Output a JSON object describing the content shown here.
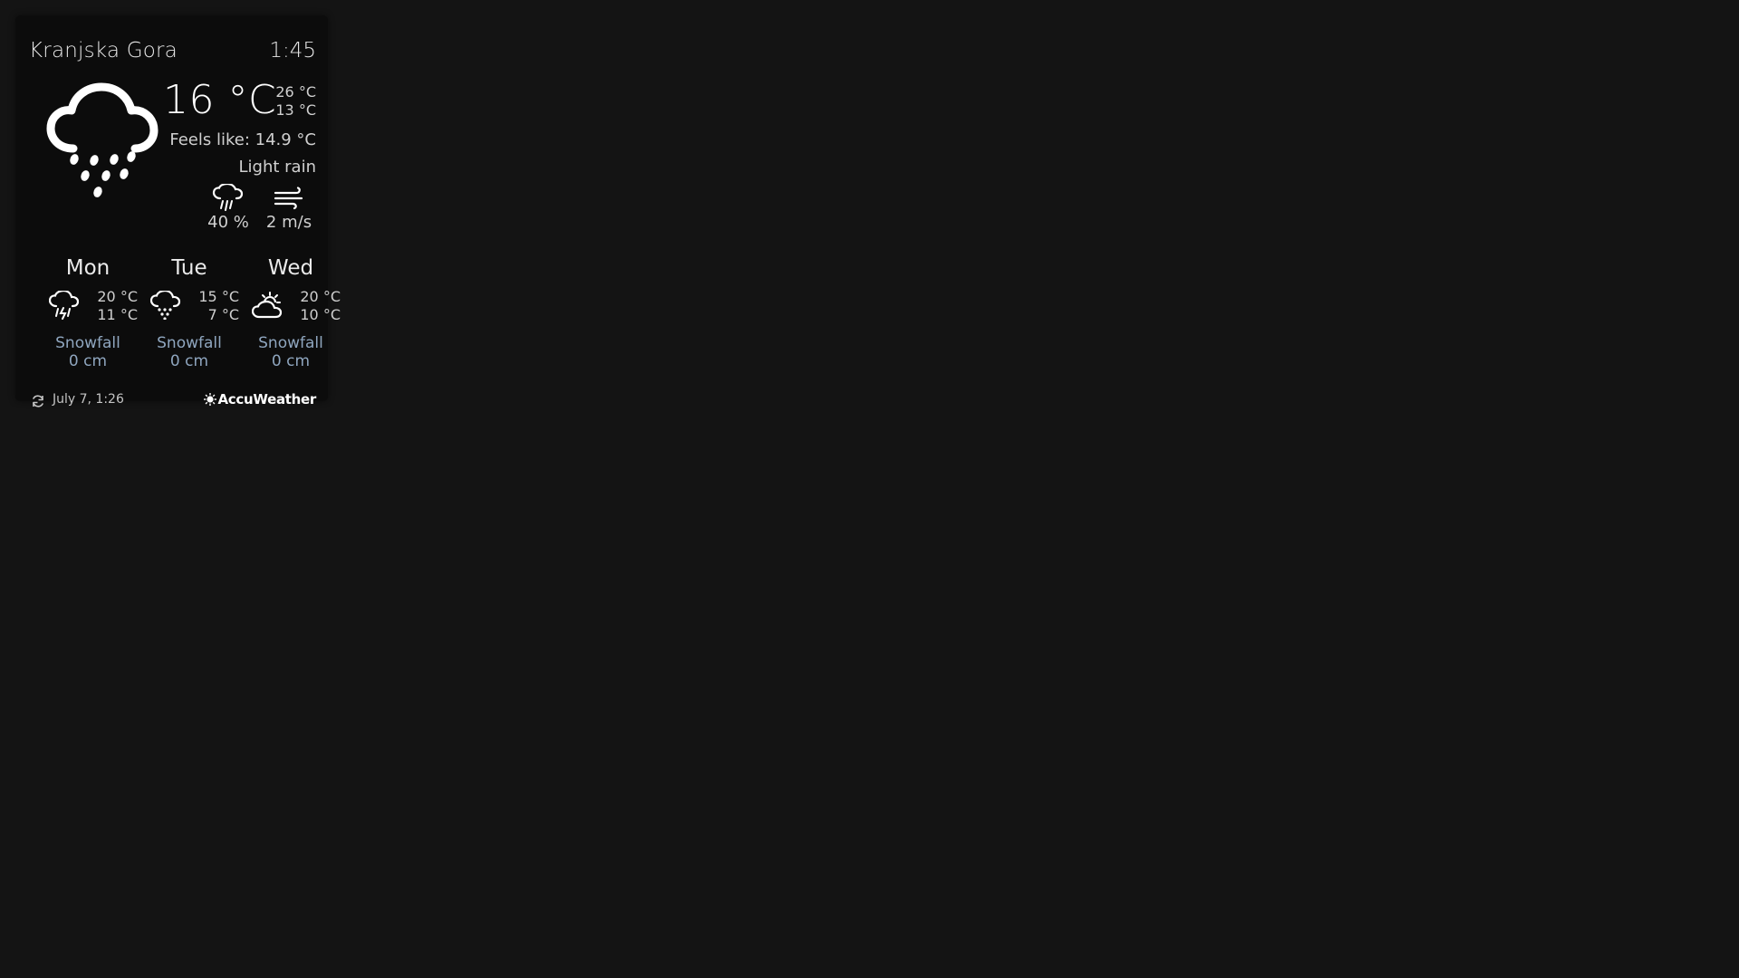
{
  "location": "Kranjska Gora",
  "time": "1:45",
  "current": {
    "temperature": "16 °C",
    "high": "26 °C",
    "low": "13 °C",
    "feels_like": "Feels like: 14.9 °C",
    "condition": "Light rain",
    "icon": "cloud-rain-icon",
    "precipitation": "40 %",
    "wind": "2 m/s"
  },
  "forecast": [
    {
      "day": "Mon",
      "high": "20 °C",
      "low": "11 °C",
      "icon": "cloud-thunderstorm-icon",
      "snow_label": "Snowfall",
      "snow_value": "0 cm"
    },
    {
      "day": "Tue",
      "high": "15 °C",
      "low": "7 °C",
      "icon": "cloud-rain-icon",
      "snow_label": "Snowfall",
      "snow_value": "0 cm"
    },
    {
      "day": "Wed",
      "high": "20 °C",
      "low": "10 °C",
      "icon": "partly-cloudy-icon",
      "snow_label": "Snowfall",
      "snow_value": "0 cm"
    }
  ],
  "footer": {
    "updated": "July  7, 1:26",
    "provider": "AccuWeather"
  },
  "colors": {
    "background": "#141414",
    "widget": "#0a0a0a",
    "snow_text": "#8fa6bf"
  }
}
